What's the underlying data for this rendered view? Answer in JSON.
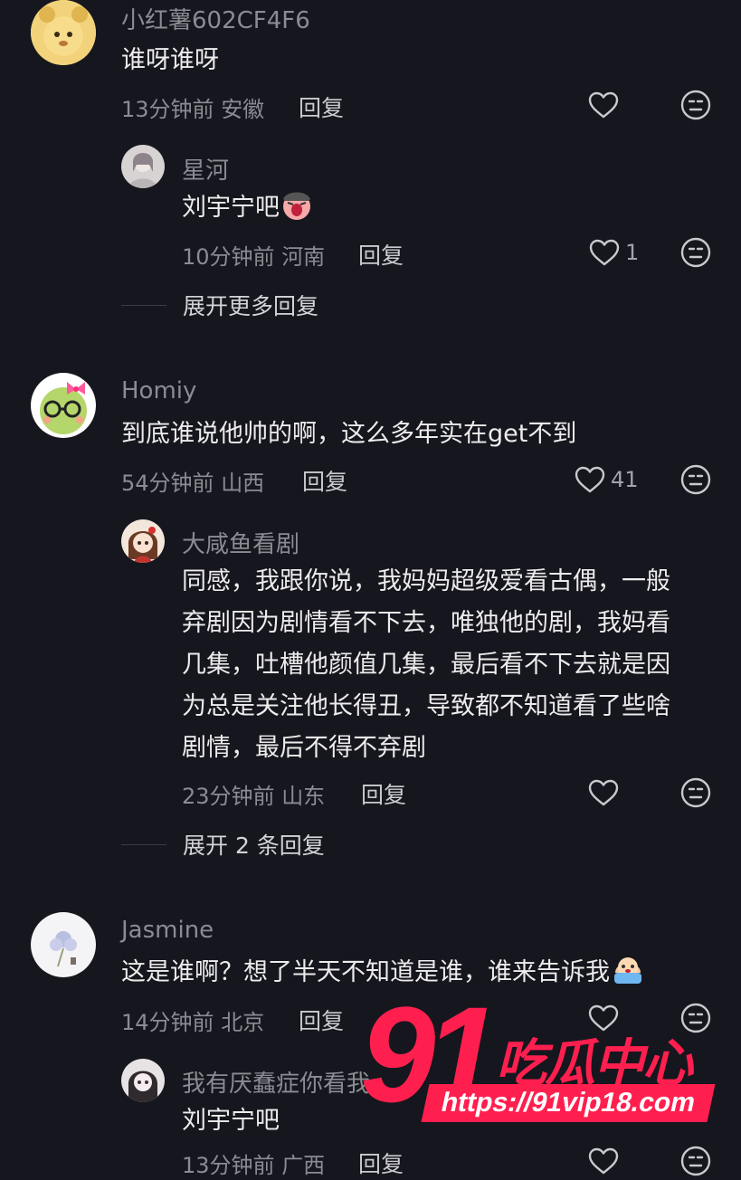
{
  "comments": [
    {
      "username": "小红薯602CF4F6",
      "text": "谁呀谁呀",
      "time": "13分钟前",
      "location": "安徽",
      "reply_label": "回复",
      "likes": "",
      "replies": [
        {
          "username": "星河",
          "text": "刘宇宁吧",
          "time": "10分钟前",
          "location": "河南",
          "reply_label": "回复",
          "likes": "1"
        }
      ],
      "expand_label": "展开更多回复"
    },
    {
      "username": "Homiy",
      "text": "到底谁说他帅的啊，这么多年实在get不到",
      "time": "54分钟前",
      "location": "山西",
      "reply_label": "回复",
      "likes": "41",
      "replies": [
        {
          "username": "大咸鱼看剧",
          "text_lines": [
            "同感，我跟你说，我妈妈超级爱看古偶，一般",
            "弃剧因为剧情看不下去，唯独他的剧，我妈看",
            "几集，吐槽他颜值几集，最后看不下去就是因",
            "为总是关注他长得丑，导致都不知道看了些啥",
            "剧情，最后不得不弃剧"
          ],
          "time": "23分钟前",
          "location": "山东",
          "reply_label": "回复",
          "likes": ""
        }
      ],
      "expand_label": "展开 2 条回复"
    },
    {
      "username": "Jasmine",
      "text": "这是谁啊？想了半天不知道是谁，谁来告诉我",
      "time": "14分钟前",
      "location": "北京",
      "reply_label": "回复",
      "likes": "",
      "replies": [
        {
          "username": "我有厌蠢症你看我",
          "text": "刘宇宁吧",
          "time": "13分钟前",
          "location": "广西",
          "reply_label": "回复"
        }
      ]
    }
  ],
  "icons": {
    "like": "heart-outline-icon",
    "react": "neutral-face-icon"
  },
  "watermark": {
    "number": "91",
    "name": "吃瓜中心",
    "url": "https://91vip18.com"
  },
  "colors": {
    "background": "#16161e",
    "accent": "#ff1f4f",
    "muted_text": "#8b8b93"
  }
}
